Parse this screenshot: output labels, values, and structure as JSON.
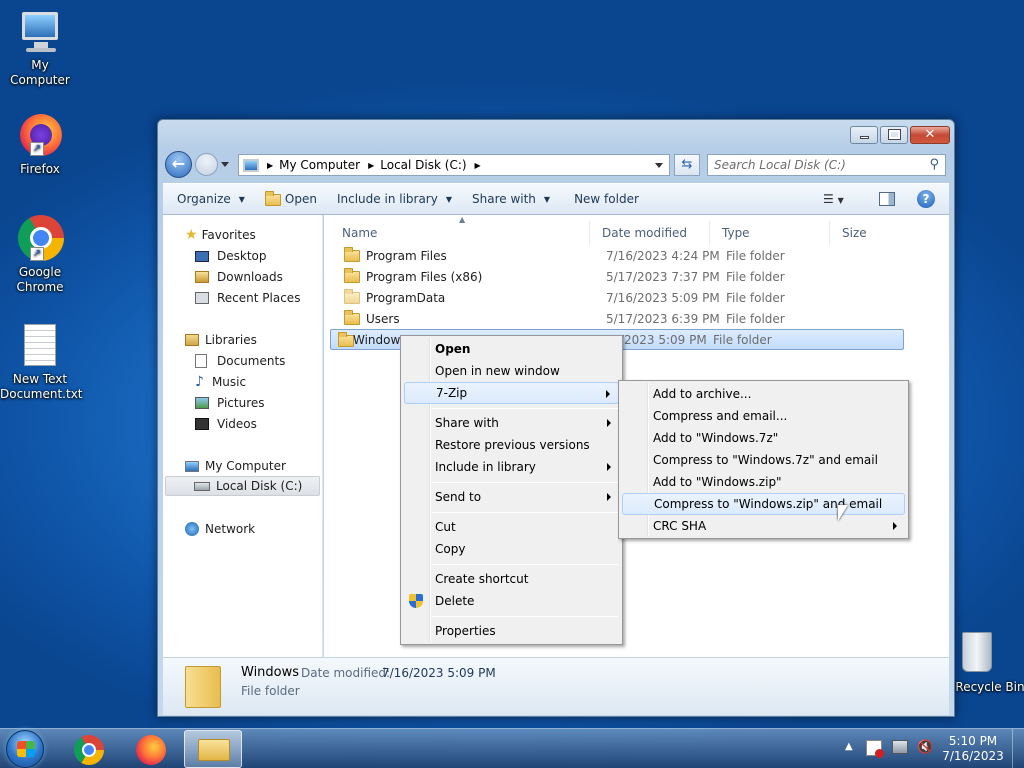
{
  "desktop": {
    "icons": [
      {
        "label": "My Computer"
      },
      {
        "label": "Firefox"
      },
      {
        "label": "Google Chrome"
      },
      {
        "label": "New Text Document.txt"
      },
      {
        "label": "Recycle Bin"
      }
    ]
  },
  "explorer": {
    "breadcrumb": [
      "My Computer",
      "Local Disk (C:)"
    ],
    "search_placeholder": "Search Local Disk (C:)",
    "toolbar": {
      "organize": "Organize",
      "open": "Open",
      "include": "Include in library",
      "share": "Share with",
      "new_folder": "New folder"
    },
    "nav": {
      "favorites": "Favorites",
      "desktop": "Desktop",
      "downloads": "Downloads",
      "recent": "Recent Places",
      "libraries": "Libraries",
      "documents": "Documents",
      "music": "Music",
      "pictures": "Pictures",
      "videos": "Videos",
      "computer": "My Computer",
      "local_disk": "Local Disk (C:)",
      "network": "Network"
    },
    "columns": [
      "Name",
      "Date modified",
      "Type",
      "Size"
    ],
    "files": [
      {
        "name": "Program Files",
        "date": "7/16/2023 4:24 PM",
        "type": "File folder"
      },
      {
        "name": "Program Files (x86)",
        "date": "5/17/2023 7:37 PM",
        "type": "File folder"
      },
      {
        "name": "ProgramData",
        "date": "7/16/2023 5:09 PM",
        "type": "File folder"
      },
      {
        "name": "Users",
        "date": "5/17/2023 6:39 PM",
        "type": "File folder"
      },
      {
        "name": "Windows",
        "date": "7/16/2023 5:09 PM",
        "type": "File folder"
      }
    ],
    "details": {
      "name": "Windows",
      "date_label": "Date modified:",
      "date_value": "7/16/2023 5:09 PM",
      "type": "File folder"
    }
  },
  "context_menu": {
    "open": "Open",
    "open_new": "Open in new window",
    "zip": "7-Zip",
    "share": "Share with",
    "restore": "Restore previous versions",
    "include": "Include in library",
    "send": "Send to",
    "cut": "Cut",
    "copy": "Copy",
    "shortcut": "Create shortcut",
    "delete": "Delete",
    "properties": "Properties"
  },
  "zip_menu": {
    "add_archive": "Add to archive...",
    "compress_email": "Compress and email...",
    "add_7z": "Add to \"Windows.7z\"",
    "compress_7z_email": "Compress to \"Windows.7z\" and email",
    "add_zip": "Add to \"Windows.zip\"",
    "compress_zip_email": "Compress to \"Windows.zip\" and email",
    "crc": "CRC SHA"
  },
  "taskbar": {
    "time": "5:10 PM",
    "date": "7/16/2023"
  }
}
